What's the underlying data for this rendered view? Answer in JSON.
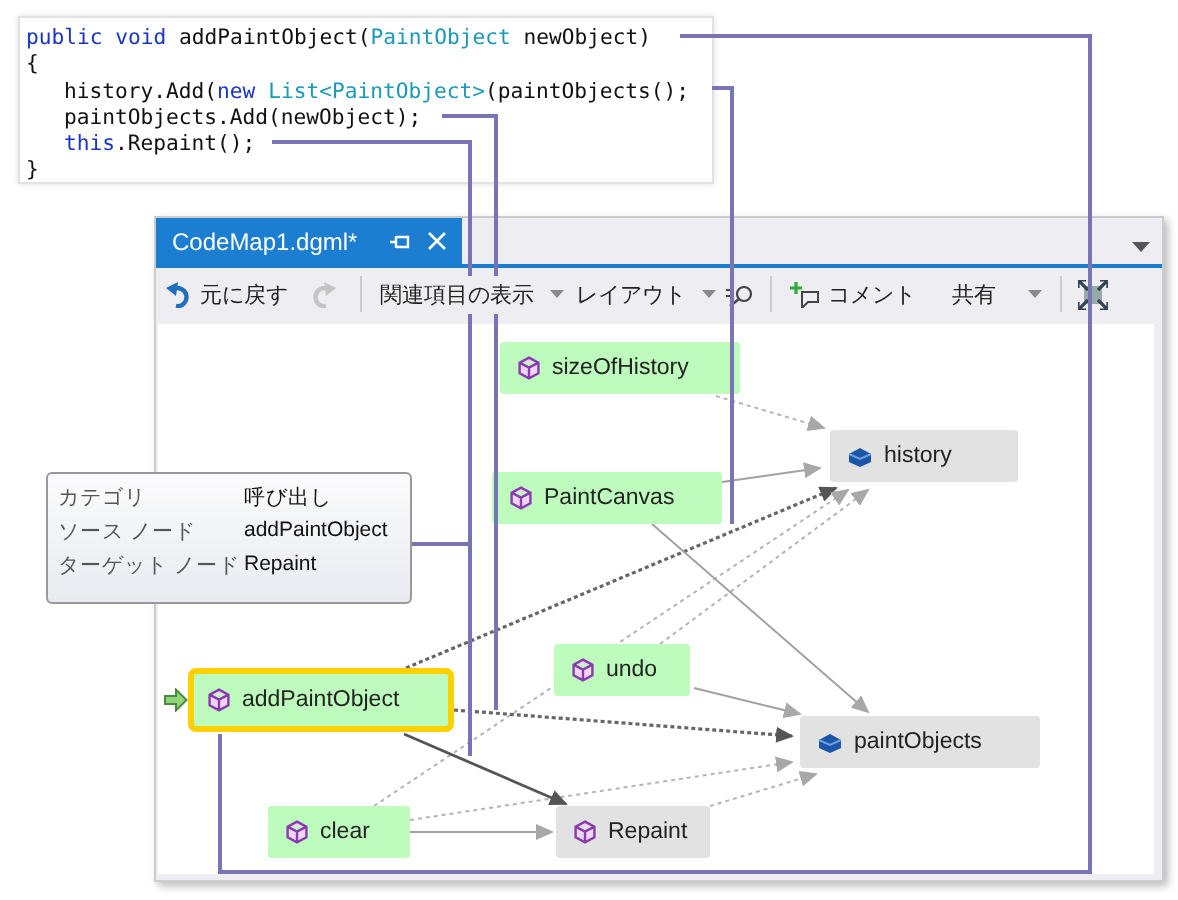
{
  "code": {
    "lines": [
      {
        "indented": false,
        "tokens": [
          {
            "kind": "keyword",
            "text": "public void"
          },
          {
            "kind": "plain",
            "text": " addPaintObject("
          },
          {
            "kind": "type",
            "text": "PaintObject"
          },
          {
            "kind": "plain",
            "text": " newObject)"
          }
        ]
      },
      {
        "indented": false,
        "tokens": [
          {
            "kind": "plain",
            "text": "{"
          }
        ]
      },
      {
        "indented": true,
        "tokens": [
          {
            "kind": "plain",
            "text": "history.Add("
          },
          {
            "kind": "keyword",
            "text": "new"
          },
          {
            "kind": "type",
            "text": " List<PaintObject>"
          },
          {
            "kind": "plain",
            "text": "(paintObjects();"
          }
        ]
      },
      {
        "indented": true,
        "tokens": [
          {
            "kind": "plain",
            "text": "paintObjects.Add(newObject);"
          }
        ]
      },
      {
        "indented": true,
        "tokens": [
          {
            "kind": "keyword",
            "text": "this"
          },
          {
            "kind": "plain",
            "text": ".Repaint();"
          }
        ]
      },
      {
        "indented": false,
        "tokens": [
          {
            "kind": "plain",
            "text": "}"
          }
        ]
      }
    ]
  },
  "window": {
    "tab_title": "CodeMap1.dgml*"
  },
  "toolbar": {
    "undo": "元に戻す",
    "redo_disabled": true,
    "show_related": "関連項目の表示",
    "layout": "レイアウト",
    "comment": "コメント",
    "share": "共有"
  },
  "tooltip": {
    "rows": [
      {
        "label": "カテゴリ",
        "value": "呼び出し"
      },
      {
        "label": "ソース ノード",
        "value": "addPaintObject"
      },
      {
        "label": "ターゲット ノード",
        "value": "Repaint"
      }
    ]
  },
  "nodes": [
    {
      "label": "sizeOfHistory",
      "kind": "method",
      "highlighted": true,
      "selected": false,
      "entry_point": false
    },
    {
      "label": "history",
      "kind": "field",
      "highlighted": false,
      "selected": false,
      "entry_point": false
    },
    {
      "label": "PaintCanvas",
      "kind": "method",
      "highlighted": true,
      "selected": false,
      "entry_point": false
    },
    {
      "label": "undo",
      "kind": "method",
      "highlighted": true,
      "selected": false,
      "entry_point": false
    },
    {
      "label": "addPaintObject",
      "kind": "method",
      "highlighted": true,
      "selected": true,
      "entry_point": true
    },
    {
      "label": "paintObjects",
      "kind": "field",
      "highlighted": false,
      "selected": false,
      "entry_point": false
    },
    {
      "label": "clear",
      "kind": "method",
      "highlighted": true,
      "selected": false,
      "entry_point": false
    },
    {
      "label": "Repaint",
      "kind": "method",
      "highlighted": false,
      "selected": false,
      "entry_point": false
    }
  ]
}
